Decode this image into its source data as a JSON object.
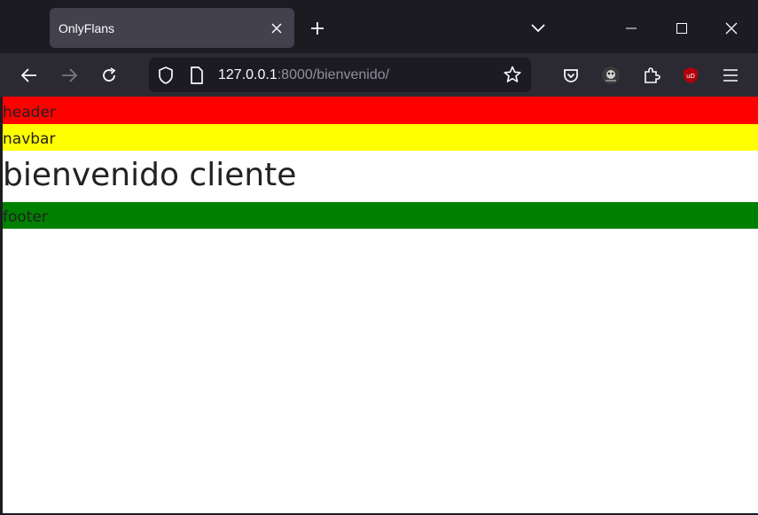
{
  "browser": {
    "tab": {
      "title": "OnlyFlans"
    },
    "url": {
      "host": "127.0.0.1",
      "rest": ":8000/bienvenido/"
    }
  },
  "page": {
    "header": "header",
    "navbar": "navbar",
    "heading": "bienvenido cliente",
    "footer": "footer"
  },
  "colors": {
    "header": "#ff0000",
    "navbar": "#ffff00",
    "footer": "#008000",
    "chrome_dark": "#1c1b22",
    "toolbar": "#2b2a33",
    "tab": "#42414d"
  },
  "icons": {
    "tab_close": "close-icon",
    "new_tab": "plus-icon",
    "list_tabs": "chevron-down-icon",
    "back": "back-arrow-icon",
    "forward": "forward-arrow-icon",
    "reload": "reload-icon",
    "tracking": "shield-icon",
    "page_info": "page-icon",
    "bookmark": "star-icon",
    "pocket": "pocket-icon",
    "extension_avatar": "extension-avatar-icon",
    "extensions": "puzzle-icon",
    "ublock": "ublock-icon",
    "menu": "hamburger-menu-icon"
  }
}
